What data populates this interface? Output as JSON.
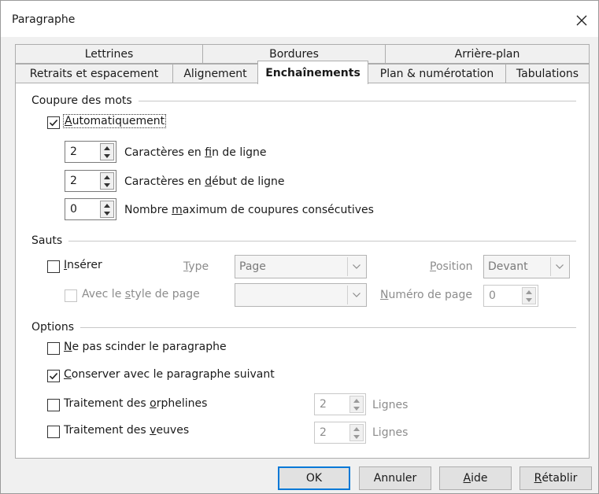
{
  "window": {
    "title": "Paragraphe"
  },
  "tabs": {
    "row1": [
      "Lettrines",
      "Bordures",
      "Arrière-plan"
    ],
    "row2": [
      "Retraits et espacement",
      "Alignement",
      "Enchaînements",
      "Plan & numérotation",
      "Tabulations"
    ],
    "active": "Enchaînements"
  },
  "hyphenation": {
    "legend": "Coupure des mots",
    "auto": {
      "pre": "",
      "key": "A",
      "post": "utomatiquement",
      "checked": true
    },
    "end_chars": {
      "value": "2",
      "pre": "Caractères en ",
      "key": "f",
      "post": "in de ligne"
    },
    "start_chars": {
      "value": "2",
      "pre": "Caractères en ",
      "key": "d",
      "post": "ébut de ligne"
    },
    "max_consecutive": {
      "value": "0",
      "pre": "Nombre ",
      "key": "m",
      "post": "aximum de coupures consécutives"
    }
  },
  "breaks": {
    "legend": "Sauts",
    "insert": {
      "pre": "",
      "key": "I",
      "post": "nsérer",
      "checked": false
    },
    "type": {
      "pre": "",
      "key": "T",
      "post": "ype",
      "value": "Page"
    },
    "position": {
      "pre": "",
      "key": "P",
      "post": "osition",
      "value": "Devant"
    },
    "page_style": {
      "pre": "Avec le ",
      "key": "s",
      "post": "tyle de page",
      "value": ""
    },
    "page_number": {
      "pre": "",
      "key": "N",
      "post": "uméro de page",
      "value": "0"
    }
  },
  "options": {
    "legend": "Options",
    "keep_together": {
      "pre": "",
      "key": "N",
      "post": "e pas scinder le paragraphe",
      "checked": false
    },
    "keep_with_next": {
      "pre": "",
      "key": "C",
      "post": "onserver avec le paragraphe suivant",
      "checked": true
    },
    "orphan": {
      "pre": "Traitement des ",
      "key": "o",
      "post": "rphelines",
      "value": "2",
      "unit": "Lignes",
      "checked": false
    },
    "widow": {
      "pre": "Traitement des ",
      "key": "v",
      "post": "euves",
      "value": "2",
      "unit": "Lignes",
      "checked": false
    }
  },
  "buttons": {
    "ok": {
      "pre": "",
      "key": "",
      "post": "OK"
    },
    "cancel": {
      "pre": "",
      "key": "",
      "post": "Annuler"
    },
    "help": {
      "pre": "",
      "key": "A",
      "post": "ide"
    },
    "reset": {
      "pre": "",
      "key": "R",
      "post": "établir"
    }
  },
  "icons": {
    "close": "close-icon",
    "check": "checkmark-icon",
    "spin": "spin-arrows-icon",
    "dropdown": "chevron-down-icon",
    "smiley": "smiley-face-icon"
  },
  "colors": {
    "smiley_fill": "#f2421b",
    "smiley_stroke": "#c93512",
    "default_button": "#0078d7"
  }
}
